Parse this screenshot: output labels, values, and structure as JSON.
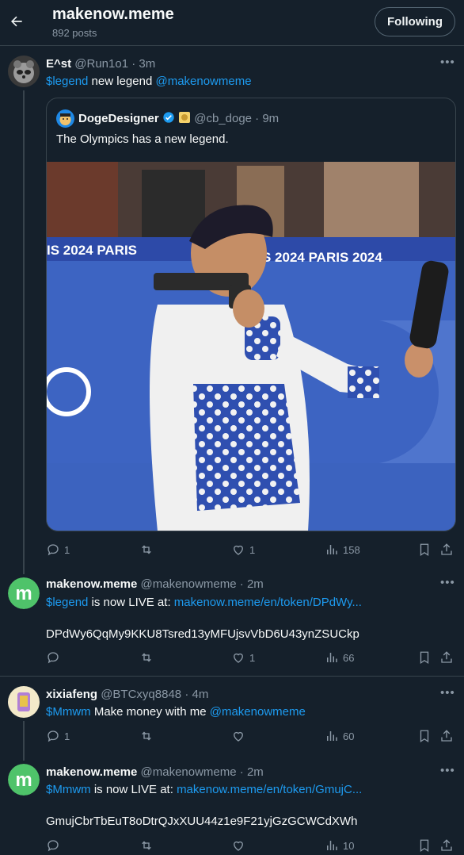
{
  "header": {
    "title": "makenow.meme",
    "subtitle": "892 posts",
    "follow_label": "Following"
  },
  "tweets": [
    {
      "name": "E^st",
      "handle": "@Run1o1",
      "time": "· 3m",
      "text": {
        "cashtag": "$legend",
        "middle": " new legend ",
        "mention": "@makenowmeme"
      },
      "quote": {
        "name": "DogeDesigner",
        "handle": "@cb_doge",
        "time": "· 9m",
        "text": "The Olympics has a new legend.",
        "banner1": "IS 2024   PARIS",
        "banner2": "RIS 2024   PARIS 2024"
      },
      "replies": "1",
      "likes": "1",
      "views": "158"
    },
    {
      "name": "makenow.meme",
      "handle": "@makenowmeme",
      "time": "· 2m",
      "cashtag": "$legend",
      "middle": " is now LIVE at: ",
      "url": "makenow.meme/en/token/DPdWy...",
      "address": "DPdWy6QqMy9KKU8Tsred13yMFUjsvVbD6U43ynZSUCkp",
      "likes": "1",
      "views": "66"
    },
    {
      "name": "xixiafeng",
      "handle": "@BTCxyq8848",
      "time": "· 4m",
      "cashtag": "$Mmwm",
      "middle": " Make money with me ",
      "mention": "@makenowmeme",
      "replies": "1",
      "views": "60"
    },
    {
      "name": "makenow.meme",
      "handle": "@makenowmeme",
      "time": "· 2m",
      "cashtag": "$Mmwm",
      "middle": " is now LIVE at: ",
      "url": "makenow.meme/en/token/GmujC...",
      "address": "GmujCbrTbEuT8oDtrQJxXUU44z1e9F21yjGzGCWCdXWh",
      "views": "10"
    }
  ],
  "icons": {
    "back": "arrow-left-icon",
    "more": "more-horizontal-icon",
    "reply": "reply-icon",
    "repost": "repost-icon",
    "like": "heart-icon",
    "views": "views-icon",
    "bookmark": "bookmark-icon",
    "share": "share-icon",
    "verified": "verified-badge-icon"
  },
  "colors": {
    "background": "#15202b",
    "accent": "#1d9bf0",
    "muted": "#8b98a5",
    "border": "#38444d",
    "brand_green": "#4fc36a"
  }
}
